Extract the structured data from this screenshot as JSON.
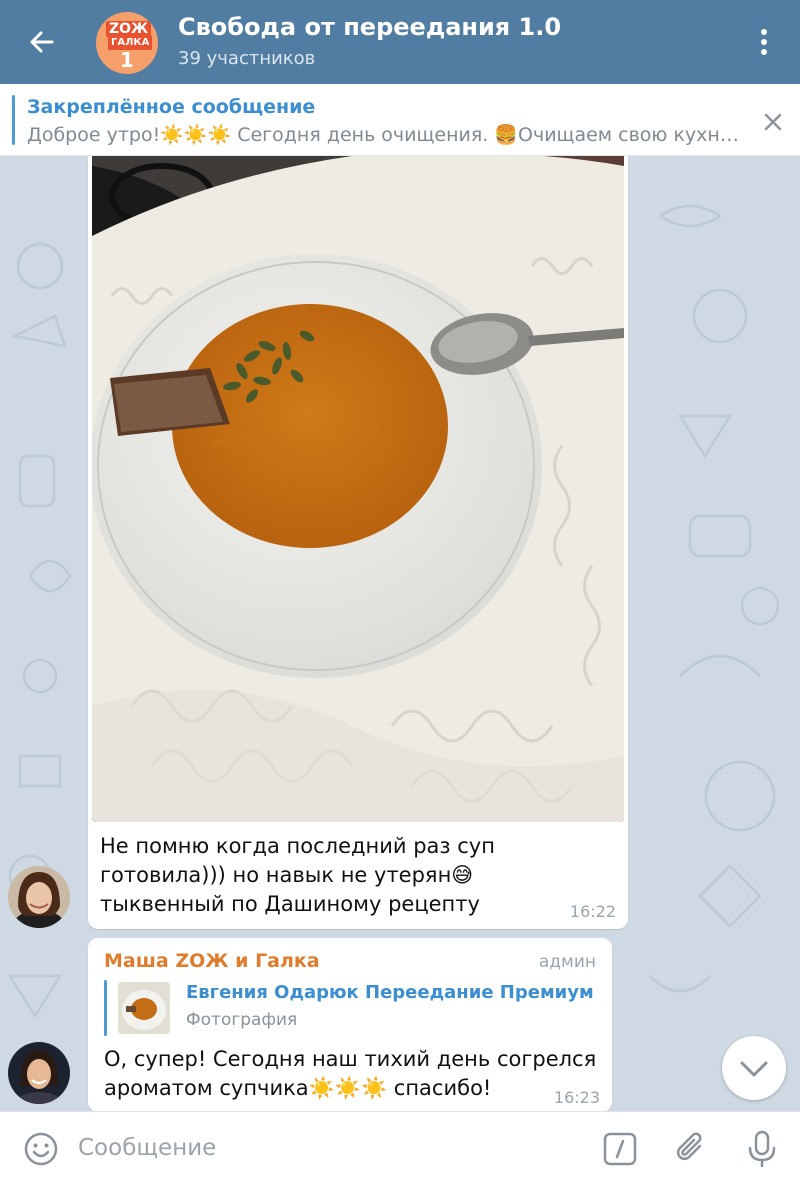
{
  "header": {
    "title": "Свобода от переедания 1.0",
    "subtitle": "39 участников",
    "avatar_logo_top": "ZOЖ",
    "avatar_logo_mid": "ГАЛКА",
    "avatar_logo_num": "1",
    "color": "#517da2"
  },
  "pinned": {
    "title": "Закреплённое сообщение",
    "text": "Доброе утро!☀️☀️☀️   Сегодня день очищения.  🍔Очищаем свою кухн…"
  },
  "messages": [
    {
      "text_line1": "Не помню когда последний раз суп",
      "text_line2": "готовила))) но навык не утерян😅",
      "text_line3": "тыквенный по Дашиному рецепту",
      "time": "16:22"
    },
    {
      "sender": "Маша ZOЖ и Галка",
      "role": "админ",
      "reply_name": "Евгения Одарюк Переедание Премиум",
      "reply_text": "Фотография",
      "text_line1": "О, супер! Сегодня наш тихий день согрелся",
      "text_line2": "ароматом супчика☀️☀️☀️ спасибо!",
      "time": "16:23"
    }
  ],
  "input": {
    "placeholder": "Сообщение"
  },
  "icons": [
    "back-arrow-icon",
    "more-vert-icon",
    "close-icon",
    "chevron-down-icon",
    "emoji-icon",
    "bot-command-icon",
    "paperclip-icon",
    "microphone-icon"
  ]
}
